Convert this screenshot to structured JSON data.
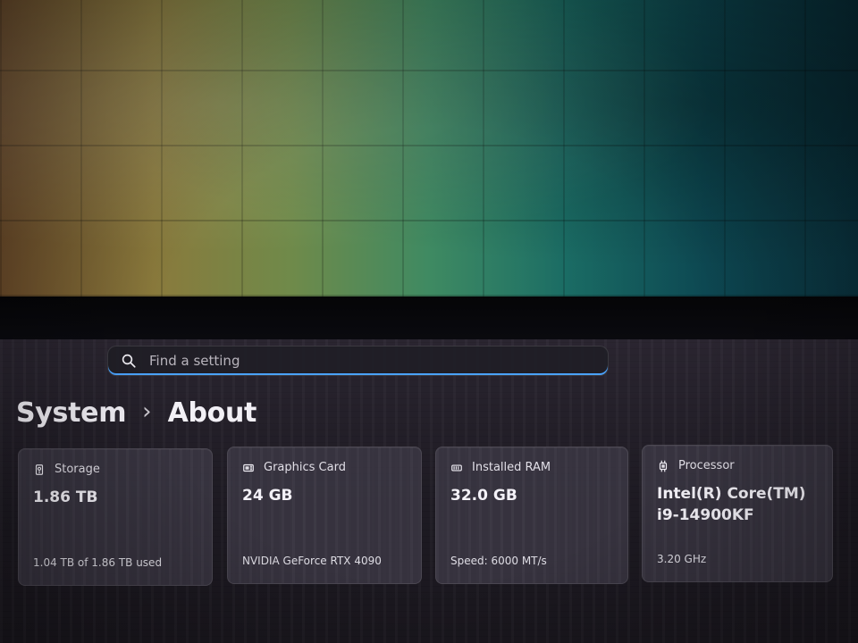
{
  "search": {
    "placeholder": "Find a setting"
  },
  "breadcrumb": {
    "items": [
      "System",
      "About"
    ],
    "separator": "›"
  },
  "cards": {
    "storage": {
      "title": "Storage",
      "value": "1.86 TB",
      "footer": "1.04 TB of 1.86 TB used",
      "icon": "storage-icon"
    },
    "gpu": {
      "title": "Graphics Card",
      "value": "24 GB",
      "footer": "NVIDIA GeForce RTX 4090",
      "icon": "graphics-card-icon"
    },
    "ram": {
      "title": "Installed RAM",
      "value": "32.0 GB",
      "footer": "Speed: 6000 MT/s",
      "icon": "ram-icon"
    },
    "cpu": {
      "title": "Processor",
      "value": "Intel(R) Core(TM)\ni9-14900KF",
      "footer": "3.20 GHz",
      "icon": "processor-icon"
    }
  },
  "theme": {
    "accent": "#4aa3ff"
  }
}
